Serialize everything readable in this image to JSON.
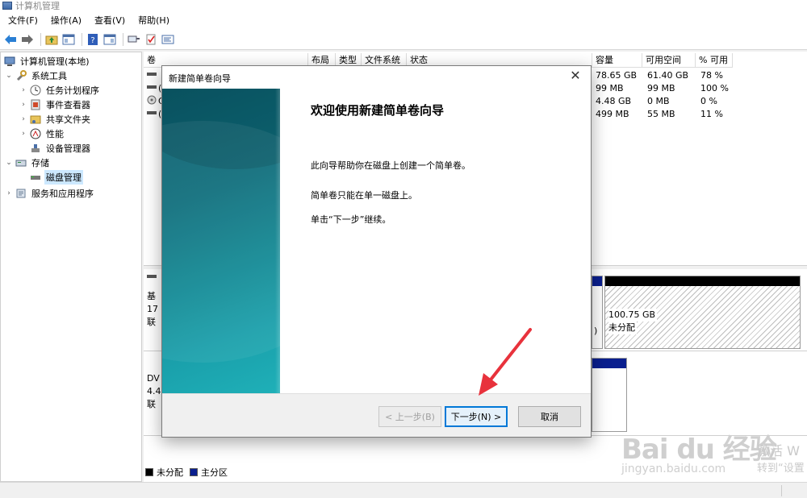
{
  "window": {
    "title": "计算机管理"
  },
  "menu": [
    "文件(F)",
    "操作(A)",
    "查看(V)",
    "帮助(H)"
  ],
  "toolbar_icons": [
    "back-arrow-icon",
    "forward-arrow-icon",
    "up-folder-icon",
    "show-hide-tree-icon",
    "help-icon",
    "panel-icon",
    "connect-icon",
    "check-icon",
    "properties-icon"
  ],
  "tree": {
    "root": "计算机管理(本地)",
    "system_tools": "系统工具",
    "task_scheduler": "任务计划程序",
    "event_viewer": "事件查看器",
    "shared_folders": "共享文件夹",
    "performance": "性能",
    "device_manager": "设备管理器",
    "storage": "存储",
    "disk_management": "磁盘管理",
    "services_apps": "服务和应用程序"
  },
  "table": {
    "headers": [
      "卷",
      "布局",
      "类型",
      "文件系统",
      "状态",
      "容量",
      "可用空间",
      "% 可用"
    ],
    "rows": [
      {
        "capacity": "78.65 GB",
        "free": "61.40 GB",
        "pct": "78 %"
      },
      {
        "capacity": "99 MB",
        "free": "99 MB",
        "pct": "100 %"
      },
      {
        "capacity": "4.48 GB",
        "free": "0 MB",
        "pct": "0 %"
      },
      {
        "capacity": "499 MB",
        "free": "55 MB",
        "pct": "11 %"
      }
    ],
    "row_prefixes": [
      "",
      "(",
      "C",
      "("
    ]
  },
  "disks": {
    "disk0_line1": "基",
    "disk0_line2": "17",
    "disk0_line3": "联",
    "disk1_line1": "DV",
    "disk1_line2": "4.4",
    "disk1_line3": "联",
    "right_paren": ")",
    "unalloc_size": "100.75 GB",
    "unalloc_label": "未分配"
  },
  "legend": {
    "unallocated": "未分配",
    "primary": "主分区"
  },
  "dialog": {
    "title": "新建简单卷向导",
    "heading": "欢迎使用新建简单卷向导",
    "p1": "此向导帮助你在磁盘上创建一个简单卷。",
    "p2": "简单卷只能在单一磁盘上。",
    "p3": "单击“下一步”继续。",
    "back": "< 上一步(B)",
    "next": "下一步(N) >",
    "cancel": "取消"
  },
  "watermark": {
    "logo": "Bai du 经验",
    "url": "jingyan.baidu.com",
    "side1": "激活 W",
    "side2": "转到“设置"
  },
  "colors": {
    "primary_partition": "#0a1f8f",
    "unallocated": "#000000",
    "accent": "#0078d7",
    "annotation": "#e8323c"
  }
}
